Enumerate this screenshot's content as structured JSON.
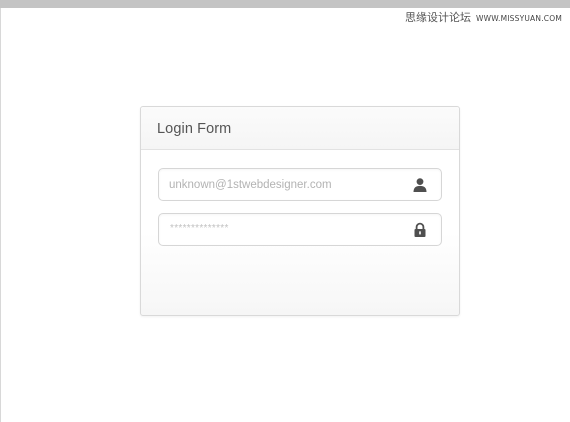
{
  "watermark": {
    "site_name": "思缘设计论坛",
    "site_url": "WWW.MISSYUAN.COM"
  },
  "login_form": {
    "title": "Login Form",
    "username": {
      "value": "",
      "placeholder": "unknown@1stwebdesigner.com",
      "icon": "user-icon"
    },
    "password": {
      "masked_text": "**************",
      "icon": "lock-icon"
    }
  },
  "colors": {
    "top_bar": "#c4c4c4",
    "card_border": "#d9d9d9",
    "title_text": "#555555",
    "icon": "#4f4f4f"
  }
}
